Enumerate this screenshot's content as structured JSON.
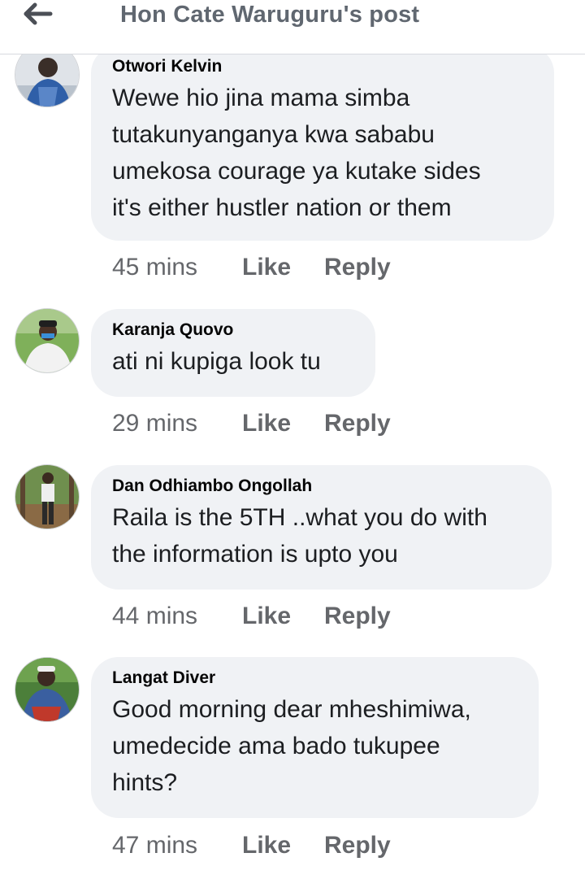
{
  "header": {
    "title": "Hon Cate Waruguru's post",
    "back_icon": "back-arrow-icon"
  },
  "comments": [
    {
      "author": "Otwori Kelvin",
      "lines": [
        "Wewe hio jina mama simba",
        "tutakunyanganya kwa sababu",
        "umekosa courage ya kutake sides",
        "it's either hustler nation or  them"
      ],
      "time": "45 mins",
      "like": "Like",
      "reply": "Reply"
    },
    {
      "author": "Karanja Quovo",
      "lines": [
        "ati ni kupiga look tu"
      ],
      "time": "29 mins",
      "like": "Like",
      "reply": "Reply"
    },
    {
      "author": "Dan Odhiambo Ongollah",
      "lines": [
        "Raila is the 5TH ..what you do with",
        "the information is upto you"
      ],
      "time": "44 mins",
      "like": "Like",
      "reply": "Reply"
    },
    {
      "author": "Langat Diver",
      "lines": [
        "Good morning dear mheshimiwa,",
        "umedecide ama bado tukupee",
        "hints?"
      ],
      "time": "47 mins",
      "like": "Like",
      "reply": "Reply"
    }
  ],
  "colors": {
    "bubble": "#f0f2f5",
    "meta_text": "#65676b",
    "header_text": "#606770"
  }
}
